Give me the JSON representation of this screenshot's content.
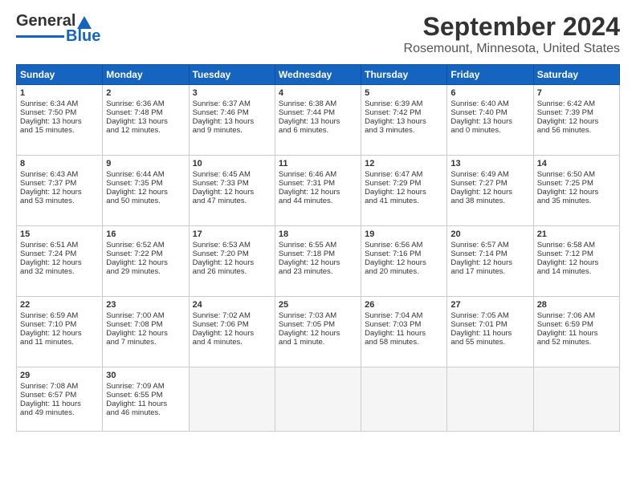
{
  "header": {
    "logo_line1": "General",
    "logo_line2": "Blue",
    "title": "September 2024",
    "subtitle": "Rosemount, Minnesota, United States"
  },
  "weekdays": [
    "Sunday",
    "Monday",
    "Tuesday",
    "Wednesday",
    "Thursday",
    "Friday",
    "Saturday"
  ],
  "weeks": [
    [
      {
        "day": "1",
        "lines": [
          "Sunrise: 6:34 AM",
          "Sunset: 7:50 PM",
          "Daylight: 13 hours",
          "and 15 minutes."
        ]
      },
      {
        "day": "2",
        "lines": [
          "Sunrise: 6:36 AM",
          "Sunset: 7:48 PM",
          "Daylight: 13 hours",
          "and 12 minutes."
        ]
      },
      {
        "day": "3",
        "lines": [
          "Sunrise: 6:37 AM",
          "Sunset: 7:46 PM",
          "Daylight: 13 hours",
          "and 9 minutes."
        ]
      },
      {
        "day": "4",
        "lines": [
          "Sunrise: 6:38 AM",
          "Sunset: 7:44 PM",
          "Daylight: 13 hours",
          "and 6 minutes."
        ]
      },
      {
        "day": "5",
        "lines": [
          "Sunrise: 6:39 AM",
          "Sunset: 7:42 PM",
          "Daylight: 13 hours",
          "and 3 minutes."
        ]
      },
      {
        "day": "6",
        "lines": [
          "Sunrise: 6:40 AM",
          "Sunset: 7:40 PM",
          "Daylight: 13 hours",
          "and 0 minutes."
        ]
      },
      {
        "day": "7",
        "lines": [
          "Sunrise: 6:42 AM",
          "Sunset: 7:39 PM",
          "Daylight: 12 hours",
          "and 56 minutes."
        ]
      }
    ],
    [
      {
        "day": "8",
        "lines": [
          "Sunrise: 6:43 AM",
          "Sunset: 7:37 PM",
          "Daylight: 12 hours",
          "and 53 minutes."
        ]
      },
      {
        "day": "9",
        "lines": [
          "Sunrise: 6:44 AM",
          "Sunset: 7:35 PM",
          "Daylight: 12 hours",
          "and 50 minutes."
        ]
      },
      {
        "day": "10",
        "lines": [
          "Sunrise: 6:45 AM",
          "Sunset: 7:33 PM",
          "Daylight: 12 hours",
          "and 47 minutes."
        ]
      },
      {
        "day": "11",
        "lines": [
          "Sunrise: 6:46 AM",
          "Sunset: 7:31 PM",
          "Daylight: 12 hours",
          "and 44 minutes."
        ]
      },
      {
        "day": "12",
        "lines": [
          "Sunrise: 6:47 AM",
          "Sunset: 7:29 PM",
          "Daylight: 12 hours",
          "and 41 minutes."
        ]
      },
      {
        "day": "13",
        "lines": [
          "Sunrise: 6:49 AM",
          "Sunset: 7:27 PM",
          "Daylight: 12 hours",
          "and 38 minutes."
        ]
      },
      {
        "day": "14",
        "lines": [
          "Sunrise: 6:50 AM",
          "Sunset: 7:25 PM",
          "Daylight: 12 hours",
          "and 35 minutes."
        ]
      }
    ],
    [
      {
        "day": "15",
        "lines": [
          "Sunrise: 6:51 AM",
          "Sunset: 7:24 PM",
          "Daylight: 12 hours",
          "and 32 minutes."
        ]
      },
      {
        "day": "16",
        "lines": [
          "Sunrise: 6:52 AM",
          "Sunset: 7:22 PM",
          "Daylight: 12 hours",
          "and 29 minutes."
        ]
      },
      {
        "day": "17",
        "lines": [
          "Sunrise: 6:53 AM",
          "Sunset: 7:20 PM",
          "Daylight: 12 hours",
          "and 26 minutes."
        ]
      },
      {
        "day": "18",
        "lines": [
          "Sunrise: 6:55 AM",
          "Sunset: 7:18 PM",
          "Daylight: 12 hours",
          "and 23 minutes."
        ]
      },
      {
        "day": "19",
        "lines": [
          "Sunrise: 6:56 AM",
          "Sunset: 7:16 PM",
          "Daylight: 12 hours",
          "and 20 minutes."
        ]
      },
      {
        "day": "20",
        "lines": [
          "Sunrise: 6:57 AM",
          "Sunset: 7:14 PM",
          "Daylight: 12 hours",
          "and 17 minutes."
        ]
      },
      {
        "day": "21",
        "lines": [
          "Sunrise: 6:58 AM",
          "Sunset: 7:12 PM",
          "Daylight: 12 hours",
          "and 14 minutes."
        ]
      }
    ],
    [
      {
        "day": "22",
        "lines": [
          "Sunrise: 6:59 AM",
          "Sunset: 7:10 PM",
          "Daylight: 12 hours",
          "and 11 minutes."
        ]
      },
      {
        "day": "23",
        "lines": [
          "Sunrise: 7:00 AM",
          "Sunset: 7:08 PM",
          "Daylight: 12 hours",
          "and 7 minutes."
        ]
      },
      {
        "day": "24",
        "lines": [
          "Sunrise: 7:02 AM",
          "Sunset: 7:06 PM",
          "Daylight: 12 hours",
          "and 4 minutes."
        ]
      },
      {
        "day": "25",
        "lines": [
          "Sunrise: 7:03 AM",
          "Sunset: 7:05 PM",
          "Daylight: 12 hours",
          "and 1 minute."
        ]
      },
      {
        "day": "26",
        "lines": [
          "Sunrise: 7:04 AM",
          "Sunset: 7:03 PM",
          "Daylight: 11 hours",
          "and 58 minutes."
        ]
      },
      {
        "day": "27",
        "lines": [
          "Sunrise: 7:05 AM",
          "Sunset: 7:01 PM",
          "Daylight: 11 hours",
          "and 55 minutes."
        ]
      },
      {
        "day": "28",
        "lines": [
          "Sunrise: 7:06 AM",
          "Sunset: 6:59 PM",
          "Daylight: 11 hours",
          "and 52 minutes."
        ]
      }
    ],
    [
      {
        "day": "29",
        "lines": [
          "Sunrise: 7:08 AM",
          "Sunset: 6:57 PM",
          "Daylight: 11 hours",
          "and 49 minutes."
        ]
      },
      {
        "day": "30",
        "lines": [
          "Sunrise: 7:09 AM",
          "Sunset: 6:55 PM",
          "Daylight: 11 hours",
          "and 46 minutes."
        ]
      },
      {
        "day": "",
        "lines": []
      },
      {
        "day": "",
        "lines": []
      },
      {
        "day": "",
        "lines": []
      },
      {
        "day": "",
        "lines": []
      },
      {
        "day": "",
        "lines": []
      }
    ]
  ]
}
